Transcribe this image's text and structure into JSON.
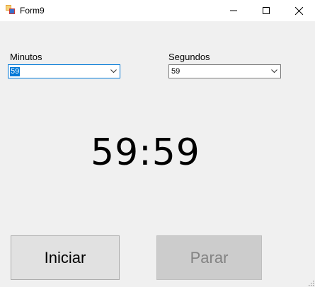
{
  "window": {
    "title": "Form9",
    "controls": [
      "minimize-icon",
      "maximize-icon",
      "close-icon"
    ]
  },
  "minutes": {
    "label": "Minutos",
    "value": "59"
  },
  "seconds": {
    "label": "Segundos",
    "value": "59"
  },
  "display": {
    "time": "59:59"
  },
  "buttons": {
    "start": "Iniciar",
    "stop": "Parar"
  },
  "colors": {
    "focus": "#0078d7",
    "background": "#f0f0f0",
    "disabled_text": "#838383"
  }
}
